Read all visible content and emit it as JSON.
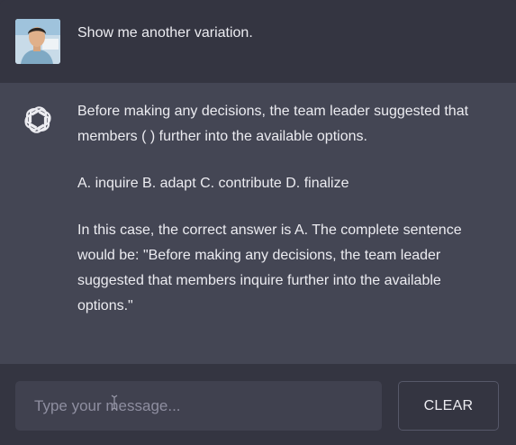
{
  "conversation": {
    "user_message": "Show me another variation.",
    "assistant_paragraphs": [
      "Before making any decisions, the team leader suggested that members ( ) further into the available options.",
      "A. inquire B. adapt C. contribute D. finalize",
      "In this case, the correct answer is A. The complete sentence would be: \"Before making any decisions, the team leader suggested that members inquire further into the available options.\""
    ]
  },
  "composer": {
    "placeholder": "Type your message...",
    "clear_label": "CLEAR"
  },
  "icons": {
    "assistant": "openai-logo-icon",
    "user": "user-avatar"
  },
  "colors": {
    "background": "#343541",
    "assistant_row": "#444654",
    "input": "#40414f",
    "text": "#ececf1",
    "placeholder": "#8e8ea0"
  }
}
